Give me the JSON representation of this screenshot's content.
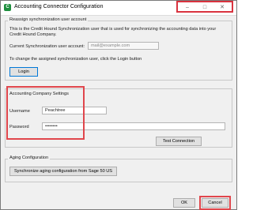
{
  "window": {
    "title": "Accounting Connector Configuration",
    "app_icon_glyph": "C",
    "controls": {
      "minimize": "–",
      "maximize": "□",
      "close": "✕"
    }
  },
  "reassign": {
    "legend": "Reassign synchronization user account",
    "description": "This is the Credit Hound Synchronization user that is used for synchronizing the accounting data into your Credit Hound Company.",
    "current_label": "Current Synchronization user account:",
    "current_value": "mail@example.com",
    "change_text": "To change the assigned synchronization user, click the Login button",
    "login_label": "Login"
  },
  "accounting": {
    "legend": "Accounting Company Settings",
    "username_label": "Username",
    "username_value": "Peachtree",
    "password_label": "Password",
    "password_value": "••••••••",
    "test_label": "Test Connection"
  },
  "aging": {
    "legend": "Aging Configuration",
    "sync_label": "Synchronize aging configuration from Sage 50 US"
  },
  "footer": {
    "ok_label": "OK",
    "cancel_label": "Cancel"
  },
  "colors": {
    "highlight": "#e0464c",
    "focus_border": "#0078d7"
  }
}
